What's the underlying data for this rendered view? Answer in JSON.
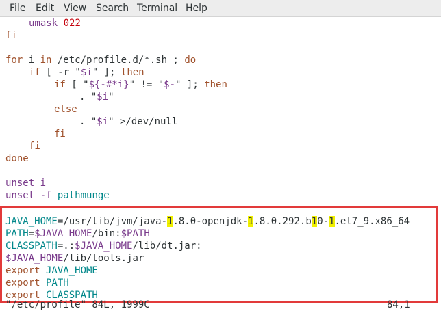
{
  "menu": {
    "items": [
      "File",
      "Edit",
      "View",
      "Search",
      "Terminal",
      "Help"
    ]
  },
  "lines": {
    "l1": {
      "kw": "umask",
      "num": "022"
    },
    "l2": "fi",
    "l3": {
      "a": "for",
      "b": " i ",
      "c": "in",
      "d": " /etc/profile.d/*.sh ; ",
      "e": "do"
    },
    "l4": {
      "a": "if",
      "b": " [ -r \"",
      "c": "$i",
      "d": "\" ]; ",
      "e": "then"
    },
    "l5": {
      "a": "if",
      "b": " [ \"",
      "c": "${-#*i}",
      "d": "\" != \"",
      "e": "$-",
      "f": "\" ]; ",
      "g": "then"
    },
    "l6": {
      "a": ". \"",
      "b": "$i",
      "c": "\""
    },
    "l7": "else",
    "l8": {
      "a": ". \"",
      "b": "$i",
      "c": "\" >/dev/null"
    },
    "l9": "fi",
    "l10": "fi",
    "l11": "done",
    "l12": {
      "a": "unset",
      "b": " i"
    },
    "l13": {
      "a": "unset",
      "b": " -f ",
      "c": "pathmunge"
    },
    "l14": {
      "a": "JAVA_HOME",
      "b": "=/usr/lib/jvm/java-",
      "h1": "1",
      "c": ".8.0-openjdk-",
      "h2": "1",
      "d": ".8.0.292.b",
      "h3": "1",
      "e": "0-",
      "h4": "1",
      "f": ".el7_9.x86_64"
    },
    "l15": {
      "a": "PATH",
      "b": "=",
      "c": "$JAVA_HOME",
      "d": "/bin:",
      "e": "$PATH"
    },
    "l16": {
      "a": "CLASSPATH",
      "b": "=.:",
      "c": "$JAVA_HOME",
      "d": "/lib/dt.jar:"
    },
    "l17": {
      "a": "$JAVA_HOME",
      "b": "/lib/tools.jar"
    },
    "l18": {
      "a": "export",
      "b": " JAVA_HOME"
    },
    "l19": {
      "a": "export",
      "b": " PATH"
    },
    "l20": {
      "a": "export",
      "b": " CLASSPATH"
    }
  },
  "status": {
    "file": "\"/etc/profile\" 84L, 1999C",
    "position": "84,1"
  }
}
